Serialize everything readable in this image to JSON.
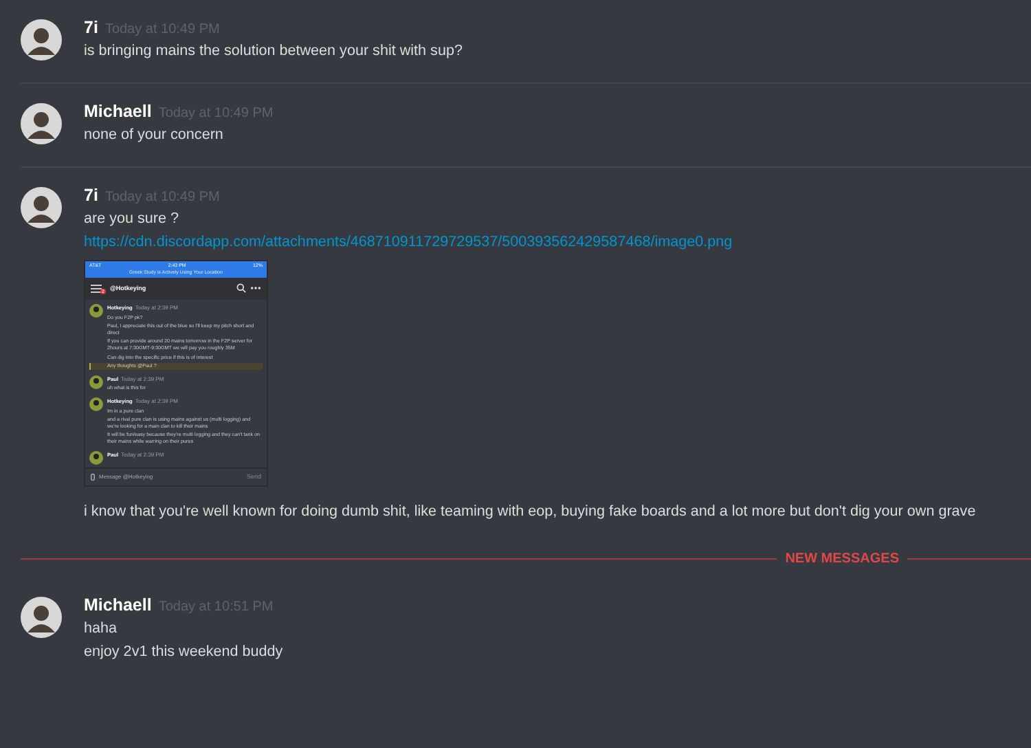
{
  "messages": [
    {
      "kind": "message",
      "author": "7i",
      "timestamp": "Today at 10:49 PM",
      "lines": [
        "is bringing mains the solution between your shit with sup?"
      ]
    },
    {
      "kind": "message",
      "author": "Michaell",
      "timestamp": "Today at 10:49 PM",
      "lines": [
        "none of your concern"
      ]
    },
    {
      "kind": "message",
      "author": "7i",
      "timestamp": "Today at 10:49 PM",
      "lines": [
        "are you sure ?"
      ],
      "link": "https://cdn.discordapp.com/attachments/468710911729729537/500393562429587468/image0.png",
      "embed": {
        "status_bar": {
          "carrier": "AT&T",
          "time": "2:43 PM",
          "battery": "12%"
        },
        "location_banner": "Greek Study is Actively Using Your Location",
        "header": {
          "badge": "2",
          "title": "@Hotkeying"
        },
        "messages": [
          {
            "author": "Hotkeying",
            "timestamp": "Today at 2:39 PM",
            "lines": [
              {
                "text": "Do you F2P pk?",
                "highlighted": false
              },
              {
                "text": "Paul, I appreciate this out of the blue so I'll keep my pitch short and direct",
                "highlighted": false
              },
              {
                "text": "If you can provide around 20 mains tomorrow in the F2P server for 2hours at 7:30GMT-9:30GMT we will pay you roughly 35M",
                "highlighted": false
              },
              {
                "text": "Can dig into the specific price if this is of interest",
                "highlighted": false
              },
              {
                "text": "Any thoughts @Paul ?",
                "highlighted": true
              }
            ]
          },
          {
            "author": "Paul",
            "timestamp": "Today at 2:39 PM",
            "lines": [
              {
                "text": "uh what is this for",
                "highlighted": false
              }
            ]
          },
          {
            "author": "Hotkeying",
            "timestamp": "Today at 2:39 PM",
            "lines": [
              {
                "text": "Im in a pure clan",
                "highlighted": false
              },
              {
                "text": "and a rival pure clan is using mains against us (multi logging) and we're looking for a main clan to kill their mains",
                "highlighted": false
              },
              {
                "text": "It will be fun/easy because they're multi logging and they can't tank on their mains while warring on their pures",
                "highlighted": false
              }
            ]
          },
          {
            "author": "Paul",
            "timestamp": "Today at 2:39 PM"
          }
        ],
        "composer": {
          "placeholder": "Message @Hotkeying",
          "send": "Send"
        }
      },
      "after": [
        "i know that you're well known for doing dumb shit, like teaming with eop, buying fake boards and a lot more but don't dig your own grave"
      ]
    },
    {
      "kind": "new_divider",
      "label": "NEW MESSAGES"
    },
    {
      "kind": "message",
      "author": "Michaell",
      "timestamp": "Today at 10:51 PM",
      "lines": [
        "haha",
        "enjoy 2v1 this weekend buddy"
      ]
    }
  ]
}
